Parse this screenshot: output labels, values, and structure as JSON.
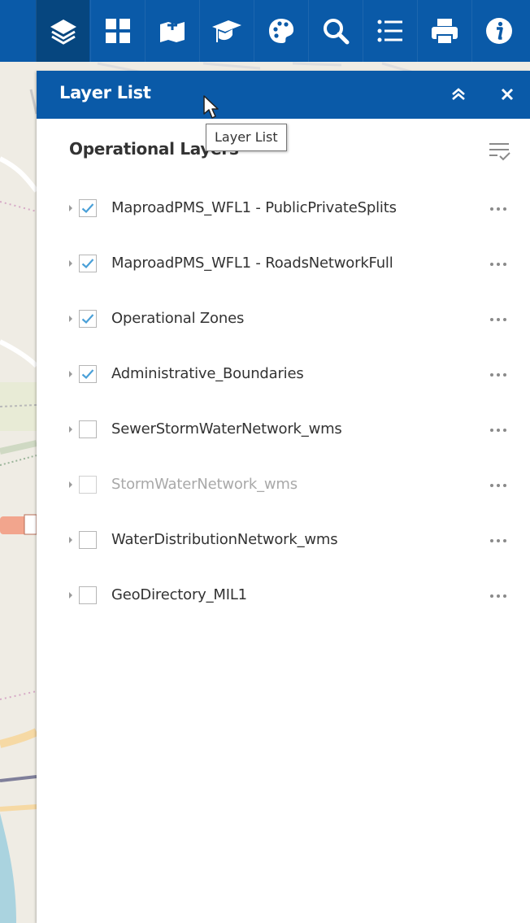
{
  "toolbar": {
    "tools": [
      {
        "icon": "layers-icon",
        "active": true
      },
      {
        "icon": "grid-icon",
        "active": false
      },
      {
        "icon": "add-data-icon",
        "active": false
      },
      {
        "icon": "graduation-cap-icon",
        "active": false
      },
      {
        "icon": "palette-icon",
        "active": false
      },
      {
        "icon": "search-icon",
        "active": false
      },
      {
        "icon": "list-icon",
        "active": false
      },
      {
        "icon": "print-icon",
        "active": false
      },
      {
        "icon": "info-icon",
        "active": false
      }
    ]
  },
  "panel": {
    "title": "Layer List",
    "section_title": "Operational Layers",
    "layers": [
      {
        "label": "MaproadPMS_WFL1 - PublicPrivateSplits",
        "checked": true,
        "dim": false
      },
      {
        "label": "MaproadPMS_WFL1 - RoadsNetworkFull",
        "checked": true,
        "dim": false
      },
      {
        "label": "Operational Zones",
        "checked": true,
        "dim": false
      },
      {
        "label": "Administrative_Boundaries",
        "checked": true,
        "dim": false
      },
      {
        "label": "SewerStormWaterNetwork_wms",
        "checked": false,
        "dim": false
      },
      {
        "label": "StormWaterNetwork_wms",
        "checked": false,
        "dim": true
      },
      {
        "label": "WaterDistributionNetwork_wms",
        "checked": false,
        "dim": false
      },
      {
        "label": "GeoDirectory_MIL1",
        "checked": false,
        "dim": false
      }
    ]
  },
  "tooltip": {
    "text": "Layer List"
  },
  "colors": {
    "header_blue": "#0a5aa8",
    "active_tool": "#06467f",
    "check_blue": "#4aa0d8"
  }
}
